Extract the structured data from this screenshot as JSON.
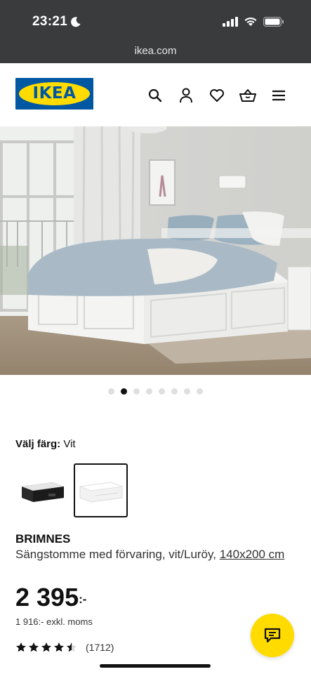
{
  "status_bar": {
    "time": "23:21"
  },
  "browser": {
    "url": "ikea.com"
  },
  "header": {
    "logo_text": "IKEA",
    "icons": [
      "search-icon",
      "account-icon",
      "favorites-icon",
      "basket-icon",
      "menu-icon"
    ]
  },
  "carousel": {
    "total": 8,
    "active_index": 1
  },
  "color_chooser": {
    "label": "Välj färg:",
    "selected_value": "Vit",
    "options": [
      "Svart",
      "Vit"
    ],
    "selected_index": 1
  },
  "product": {
    "name": "BRIMNES",
    "description": "Sängstomme med förvaring, vit/Luröy,",
    "size_link": "140x200 cm",
    "price_main": "2 395",
    "price_suffix": ":-",
    "price_excl": "1 916:- exkl. moms",
    "rating_value": 4.5,
    "rating_count": "(1712)"
  },
  "colors": {
    "ikea_blue": "#0058a3",
    "ikea_yellow": "#ffdb00",
    "browser_bar": "#3a3b3d"
  }
}
